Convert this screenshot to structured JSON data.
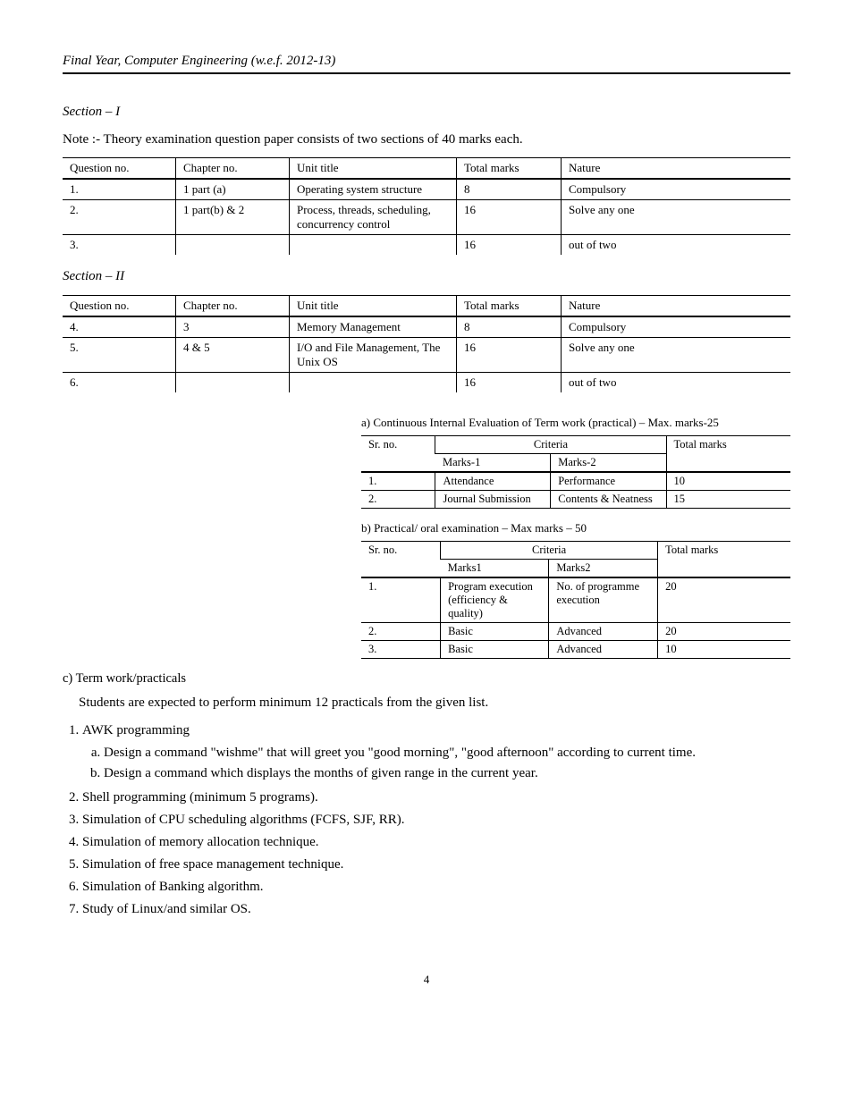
{
  "running_head": "Final Year, Computer Engineering (w.e.f. 2012-13)",
  "head1": "Section – I",
  "note1": "Note :- Theory examination question paper consists of two sections of 40 marks each.",
  "table1": {
    "headers": [
      "Question no.",
      "Chapter no.",
      "Unit title",
      "Total marks",
      "Nature"
    ],
    "rows": [
      [
        "1.",
        "1 part (a)",
        "Operating system structure",
        "8",
        "Compulsory"
      ],
      [
        "2.",
        "1 part(b) & 2",
        "Process, threads, scheduling, concurrency control",
        "16",
        "Solve any one"
      ],
      [
        "3.",
        "",
        "",
        "16",
        "out of two"
      ]
    ]
  },
  "head2": "Section – II",
  "table2": {
    "headers": [
      "Question no.",
      "Chapter no.",
      "Unit title",
      "Total marks",
      "Nature"
    ],
    "rows": [
      [
        "4.",
        "3",
        "Memory Management",
        "8",
        "Compulsory"
      ],
      [
        "5.",
        "4 & 5",
        "I/O and File Management, The Unix OS",
        "16",
        "Solve any one"
      ],
      [
        "6.",
        "",
        "",
        "16",
        "out of two"
      ]
    ]
  },
  "caption3": "a) Continuous Internal Evaluation of Term work (practical) – Max. marks-25",
  "table3": {
    "col1": "Sr. no.",
    "span": "Criteria",
    "sub": [
      "Marks-1",
      "Marks-2"
    ],
    "col4": "Total marks",
    "rows": [
      [
        "1.",
        "Attendance",
        "Performance",
        "10"
      ],
      [
        "2.",
        "Journal Submission",
        "Contents & Neatness",
        "15"
      ]
    ]
  },
  "caption4": "b) Practical/ oral examination – Max marks – 50",
  "table4": {
    "col1": "Sr. no.",
    "span": "Criteria",
    "sub": [
      "Marks1",
      "Marks2"
    ],
    "col4": "Total marks",
    "rows": [
      [
        "1.",
        "Program execution (efficiency & quality)",
        "No. of programme execution",
        "20"
      ],
      [
        "2.",
        "Basic",
        "Advanced",
        "20"
      ],
      [
        "3.",
        "Basic",
        "Advanced",
        "10"
      ]
    ]
  },
  "head3": "c)  Term work/practicals",
  "tw_intro": "Students are expected to perform minimum 12 practicals from the given list.",
  "tw_list": [
    {
      "text": "AWK programming",
      "subs": [
        "Design a command \"wishme\" that will greet you \"good morning\", \"good afternoon\" according to current time.",
        "Design a command which displays the months of given range in the current year."
      ]
    },
    {
      "text": "Shell programming (minimum 5 programs)."
    },
    {
      "text": "Simulation of CPU scheduling algorithms (FCFS, SJF, RR)."
    },
    {
      "text": "Simulation of memory allocation technique."
    },
    {
      "text": "Simulation of free space management technique."
    },
    {
      "text": "Simulation of Banking algorithm."
    },
    {
      "text": "Study of Linux/and similar OS."
    }
  ],
  "page_number": "4"
}
